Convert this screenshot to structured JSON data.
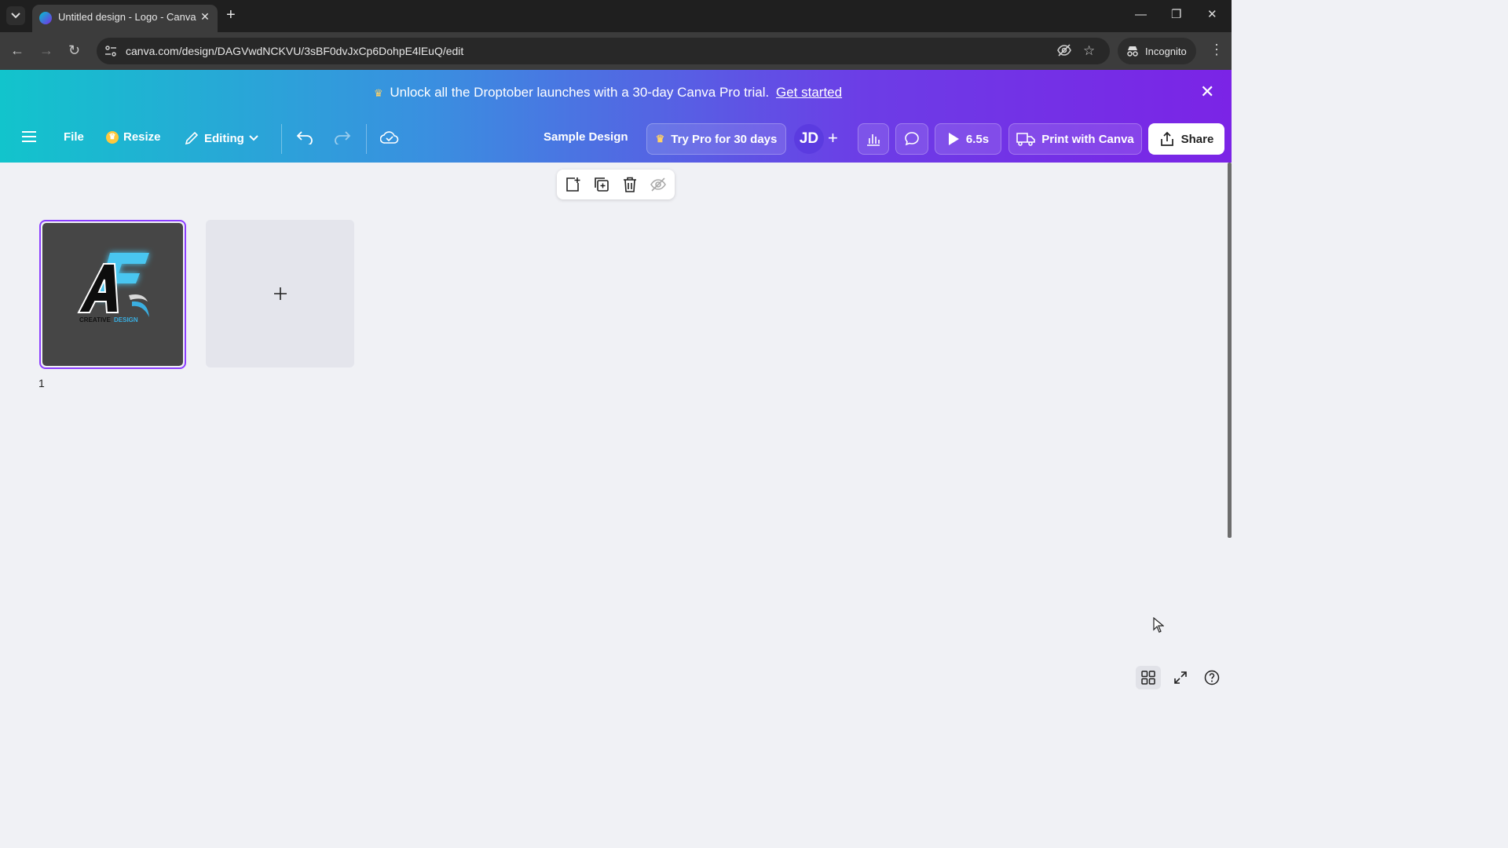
{
  "browser": {
    "tab_title": "Untitled design - Logo - Canva",
    "url": "canva.com/design/DAGVwdNCKVU/3sBF0dvJxCp6DohpE4lEuQ/edit",
    "incognito_label": "Incognito"
  },
  "promo": {
    "text": "Unlock all the Droptober launches with a 30-day Canva Pro trial.",
    "link": "Get started"
  },
  "toolbar": {
    "file": "File",
    "resize": "Resize",
    "editing": "Editing",
    "design_title": "Sample Design",
    "try_pro": "Try Pro for 30 days",
    "avatar_initials": "JD",
    "play_duration": "6.5s",
    "print": "Print with Canva",
    "share": "Share"
  },
  "canvas": {
    "page_number": "1",
    "logo_text_a": "CREATIVE",
    "logo_text_b": "DESIGN"
  },
  "colors": {
    "accent": "#8b3dff",
    "banner_start": "#12c4cc",
    "banner_end": "#7b24e6"
  }
}
